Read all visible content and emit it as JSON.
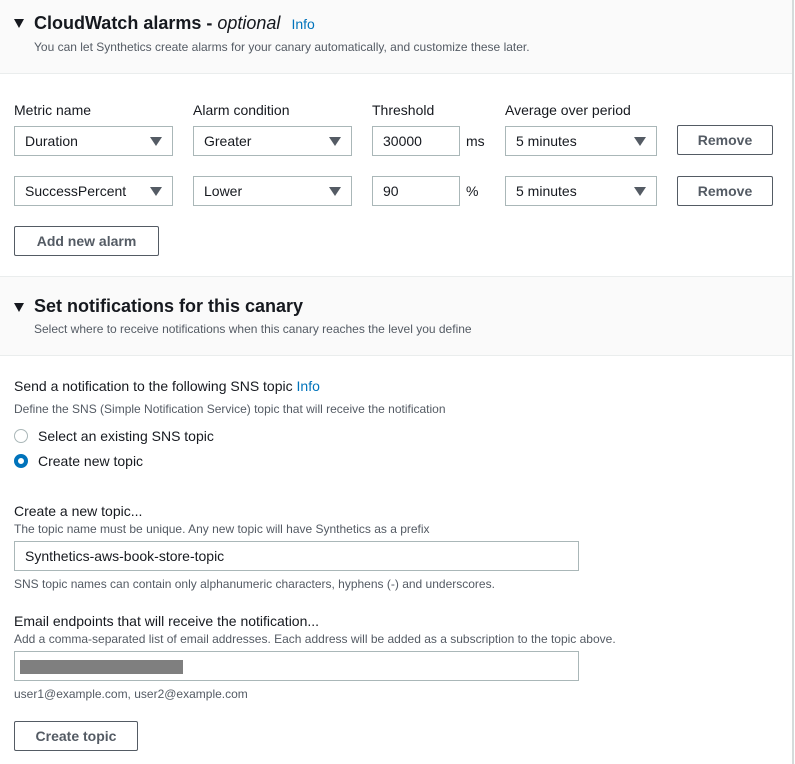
{
  "alarms_section": {
    "title": "CloudWatch alarms -",
    "title_optional": "optional",
    "info_link": "Info",
    "description": "You can let Synthetics create alarms for your canary automatically, and customize these later.",
    "columns": {
      "metric_name": "Metric name",
      "alarm_condition": "Alarm condition",
      "threshold": "Threshold",
      "average_over_period": "Average over period"
    },
    "rows": [
      {
        "metric": "Duration",
        "condition": "Greater",
        "threshold": "30000",
        "unit": "ms",
        "period": "5 minutes",
        "remove_label": "Remove"
      },
      {
        "metric": "SuccessPercent",
        "condition": "Lower",
        "threshold": "90",
        "unit": "%",
        "period": "5 minutes",
        "remove_label": "Remove"
      }
    ],
    "add_alarm_label": "Add new alarm"
  },
  "notifications_section": {
    "title": "Set notifications for this canary",
    "description": "Select where to receive notifications when this canary reaches the level you define",
    "sns_label": "Send a notification to the following SNS topic",
    "sns_info_link": "Info",
    "sns_description": "Define the SNS (Simple Notification Service) topic that will receive the notification",
    "options": [
      {
        "label": "Select an existing SNS topic",
        "selected": false
      },
      {
        "label": "Create new topic",
        "selected": true
      }
    ],
    "new_topic": {
      "label": "Create a new topic...",
      "description": "The topic name must be unique. Any new topic will have Synthetics as a prefix",
      "value": "Synthetics-aws-book-store-topic",
      "constraint": "SNS topic names can contain only alphanumeric characters, hyphens (-) and underscores."
    },
    "email": {
      "label": "Email endpoints that will receive the notification...",
      "description": "Add a comma-separated list of email addresses. Each address will be added as a subscription to the topic above.",
      "value_redacted": true,
      "hint": "user1@example.com, user2@example.com"
    },
    "create_topic_label": "Create topic"
  }
}
